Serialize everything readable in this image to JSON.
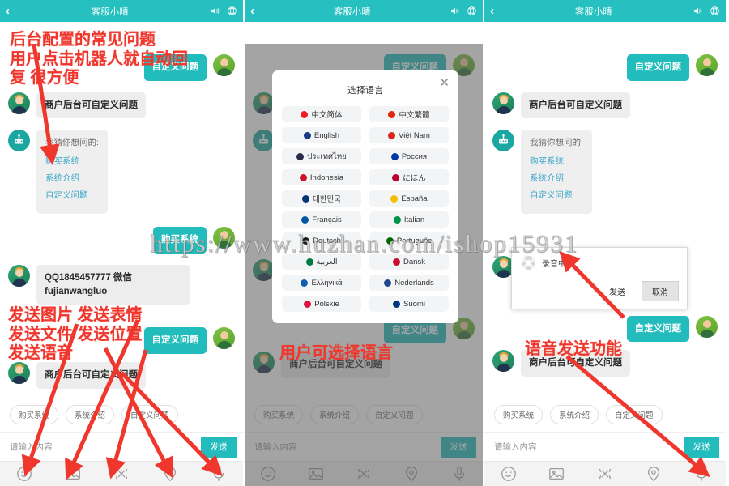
{
  "header": {
    "title": "客服小晴",
    "back_icon": "chevron-left-icon",
    "sound_icon": "speaker-icon",
    "globe_icon": "globe-icon",
    "bg_color": "#26c0c0"
  },
  "watermark": "https://www.huzhan.com/ishop15931",
  "colors": {
    "accent": "#26c0c0",
    "bubble_out": "#23bcbc",
    "bubble_in": "#ededed",
    "annotation": "#f0372e",
    "link": "#3aa6c8"
  },
  "chat": {
    "out_bubble": "自定义问题",
    "in_bubble": "商户后台可自定义问题",
    "contact_bubble": "QQ1845457777 微信fujianwangluo",
    "purchase_bubble": "购买系统",
    "faq": {
      "lead": "我猜你想问的:",
      "links": [
        "购买系统",
        "系统介绍",
        "自定义问题"
      ]
    }
  },
  "composer": {
    "chips": [
      "购买系统",
      "系统介绍",
      "自定义问题"
    ],
    "placeholder": "请输入内容",
    "send_label": "发送",
    "tools": [
      "smiley-icon",
      "image-icon",
      "file-icon",
      "location-icon",
      "microphone-icon"
    ]
  },
  "language_modal": {
    "title": "选择语言",
    "close_icon": "close-icon",
    "items": [
      {
        "label": "中文简体",
        "flag": "#ee1c25"
      },
      {
        "label": "中文繁體",
        "flag": "#de2910"
      },
      {
        "label": "English",
        "flag": "#1a3a87"
      },
      {
        "label": "Việt Nam",
        "flag": "#da251d"
      },
      {
        "label": "ประเทศไทย",
        "flag": "#2d2a4a"
      },
      {
        "label": "Россия",
        "flag": "#0039a6"
      },
      {
        "label": "Indonesia",
        "flag": "#ce1126"
      },
      {
        "label": "にほん",
        "flag": "#bc002d"
      },
      {
        "label": "대한민국",
        "flag": "#003478"
      },
      {
        "label": "España",
        "flag": "#f1bf00"
      },
      {
        "label": "Français",
        "flag": "#0055a4"
      },
      {
        "label": "Italian",
        "flag": "#009246"
      },
      {
        "label": "Deutsch",
        "flag": "#1a1a1a"
      },
      {
        "label": "Português",
        "flag": "#006600"
      },
      {
        "label": "العربية",
        "flag": "#007a3d"
      },
      {
        "label": "Dansk",
        "flag": "#c8102e"
      },
      {
        "label": "Ελληνικά",
        "flag": "#0d5eaf"
      },
      {
        "label": "Nederlands",
        "flag": "#21468b"
      },
      {
        "label": "Polskie",
        "flag": "#dc143c"
      },
      {
        "label": "Suomi",
        "flag": "#003580"
      }
    ]
  },
  "recording_modal": {
    "status": "录音中...",
    "send_label": "发送",
    "cancel_label": "取消",
    "spinner_icon": "loading-spinner-icon"
  },
  "annotations": {
    "panel1_top": "后台配置的常见问题\n用户点击机器人就自动回\n复 很方便",
    "panel1_bottom": "发送图片 发送表情\n发送文件 发送位置\n发送语音",
    "panel2": "用户可选择语言",
    "panel3": "语音发送功能"
  }
}
